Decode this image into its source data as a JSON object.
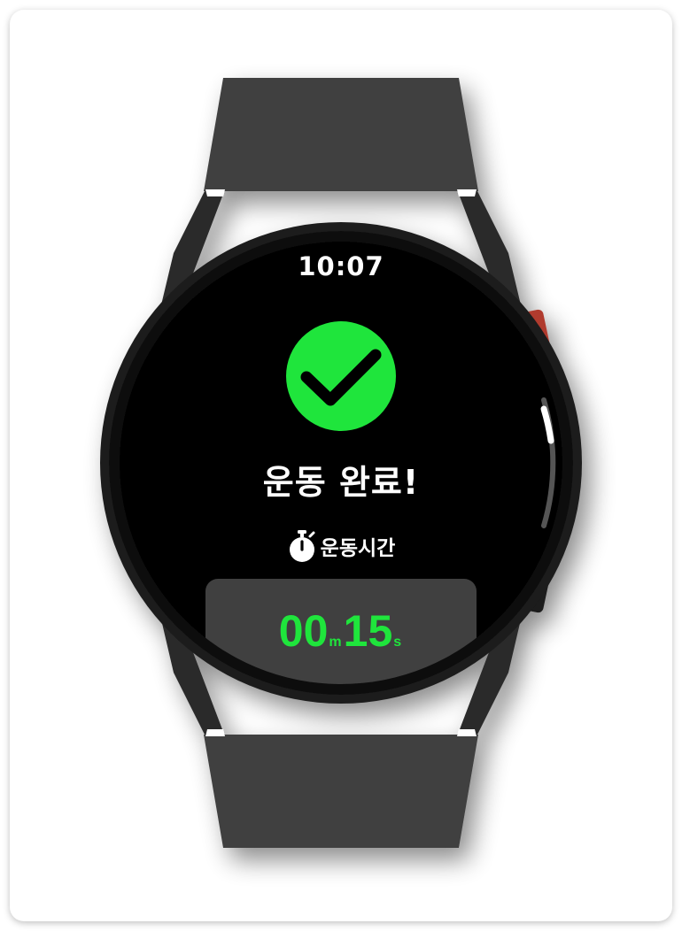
{
  "screen": {
    "time": "10:07",
    "status_icon": "check-circle-icon",
    "title": "운동 완료!",
    "timer_label": "운동시간",
    "timer_icon": "stopwatch-icon",
    "duration": {
      "minutes": "00",
      "minutes_unit": "m",
      "seconds": "15",
      "seconds_unit": "s"
    }
  },
  "colors": {
    "success": "#1fe53c",
    "screen_bg": "#000000",
    "band": "#404040",
    "crown_button": "#b03a2e"
  }
}
